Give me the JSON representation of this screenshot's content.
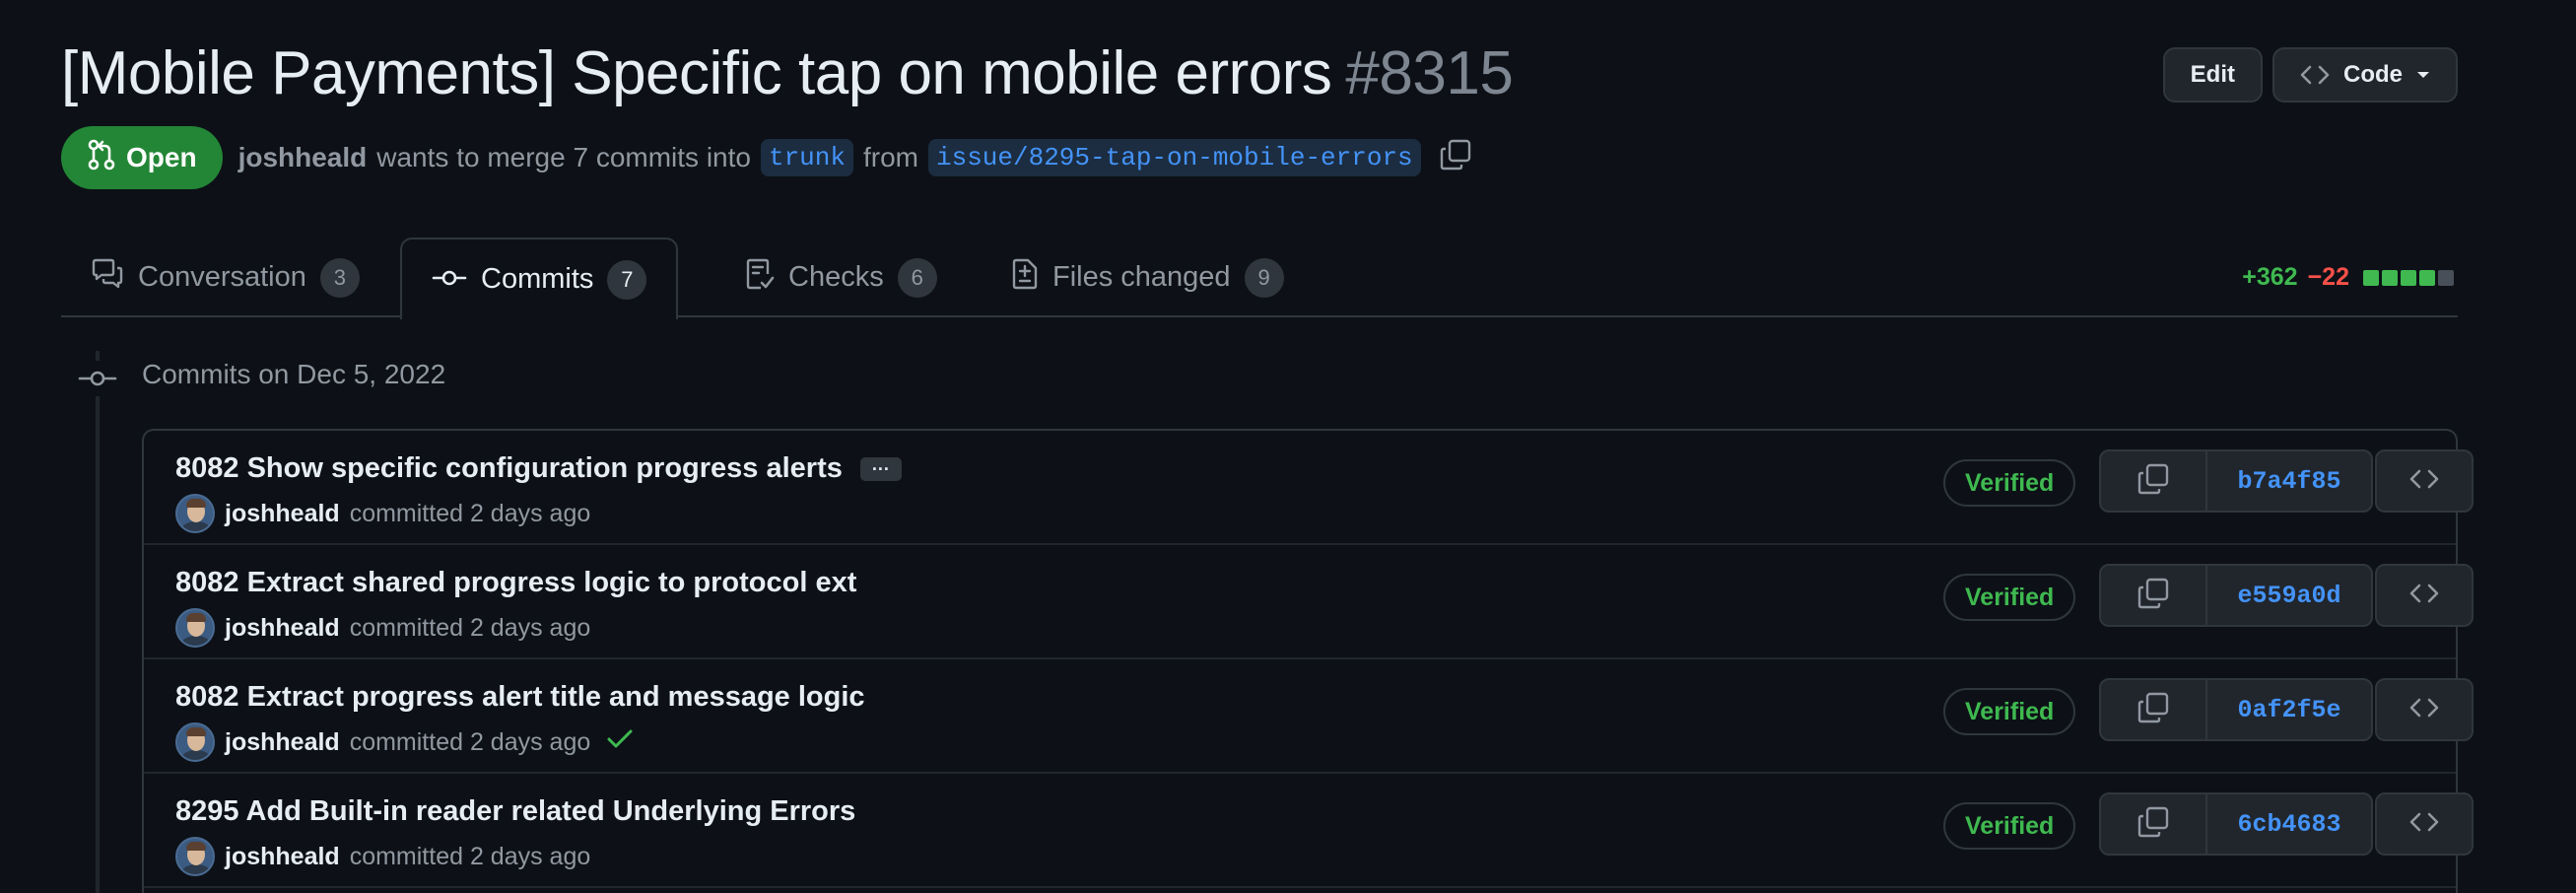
{
  "header": {
    "title": "[Mobile Payments] Specific tap on mobile errors",
    "number": "#8315",
    "edit_label": "Edit",
    "code_label": "Code"
  },
  "pr_meta": {
    "state": "Open",
    "author": "joshheald",
    "merge_text": "wants to merge 7 commits into",
    "base_branch": "trunk",
    "from_text": "from",
    "head_branch": "issue/8295-tap-on-mobile-errors"
  },
  "tabs": [
    {
      "label": "Conversation",
      "count": "3",
      "icon": "comment-discussion-icon"
    },
    {
      "label": "Commits",
      "count": "7",
      "icon": "git-commit-icon"
    },
    {
      "label": "Checks",
      "count": "6",
      "icon": "checklist-icon"
    },
    {
      "label": "Files changed",
      "count": "9",
      "icon": "file-diff-icon"
    }
  ],
  "active_tab": "Commits",
  "diffstat": {
    "additions": "+362",
    "deletions": "−22",
    "blocks": [
      "#3fb950",
      "#3fb950",
      "#3fb950",
      "#3fb950",
      "#484f58"
    ]
  },
  "timeline": {
    "date_heading": "Commits on Dec 5, 2022"
  },
  "commits": [
    {
      "message": "8082 Show specific configuration progress alerts",
      "has_ellipsis": true,
      "ellipsis": "···",
      "author": "joshheald",
      "time": "committed 2 days ago",
      "check": false,
      "verified": "Verified",
      "sha": "b7a4f85"
    },
    {
      "message": "8082 Extract shared progress logic to protocol ext",
      "has_ellipsis": false,
      "author": "joshheald",
      "time": "committed 2 days ago",
      "check": false,
      "verified": "Verified",
      "sha": "e559a0d"
    },
    {
      "message": "8082 Extract progress alert title and message logic",
      "has_ellipsis": false,
      "author": "joshheald",
      "time": "committed 2 days ago",
      "check": true,
      "verified": "Verified",
      "sha": "0af2f5e"
    },
    {
      "message": "8295 Add Built-in reader related Underlying Errors",
      "has_ellipsis": false,
      "author": "joshheald",
      "time": "committed 2 days ago",
      "check": false,
      "verified": "Verified",
      "sha": "6cb4683"
    }
  ],
  "colors": {
    "background": "#0d1117",
    "open_green": "#238636",
    "link_blue": "#4493f8",
    "verified_green": "#3fb950",
    "deletion_red": "#f85149"
  }
}
